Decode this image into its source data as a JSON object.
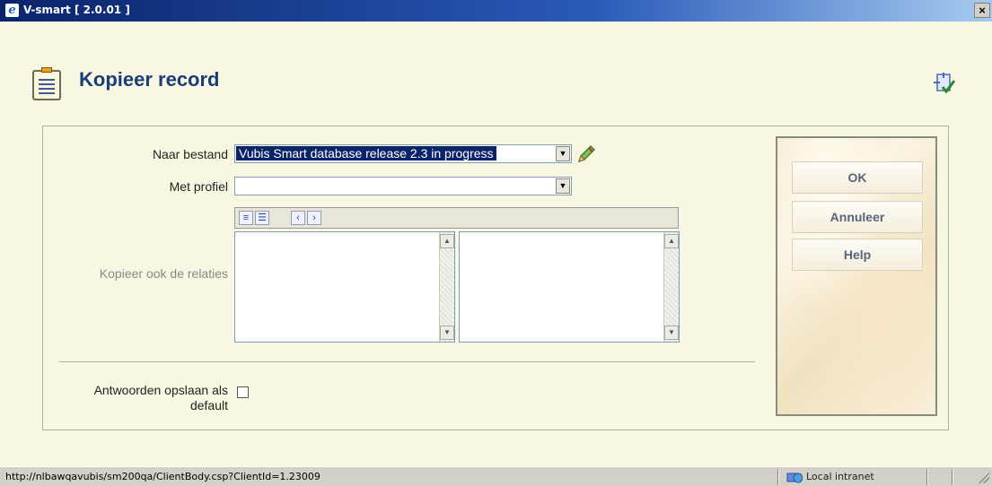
{
  "window": {
    "title": "V-smart [ 2.0.01 ]",
    "close_symbol": "×"
  },
  "page": {
    "title": "Kopieer record"
  },
  "form": {
    "naar_bestand": {
      "label": "Naar bestand",
      "value": "Vubis Smart database release 2.3 in progress"
    },
    "met_profiel": {
      "label": "Met profiel",
      "value": ""
    },
    "relaties": {
      "label": "Kopieer ook de relaties"
    },
    "default": {
      "label_line1": "Antwoorden opslaan als",
      "label_line2": "default",
      "checked": false
    }
  },
  "buttons": {
    "ok": "OK",
    "cancel": "Annuleer",
    "help": "Help"
  },
  "statusbar": {
    "url": "http://nlbawqavubis/sm200qa/ClientBody.csp?ClientId=1.23009",
    "zone": "Local intranet"
  }
}
